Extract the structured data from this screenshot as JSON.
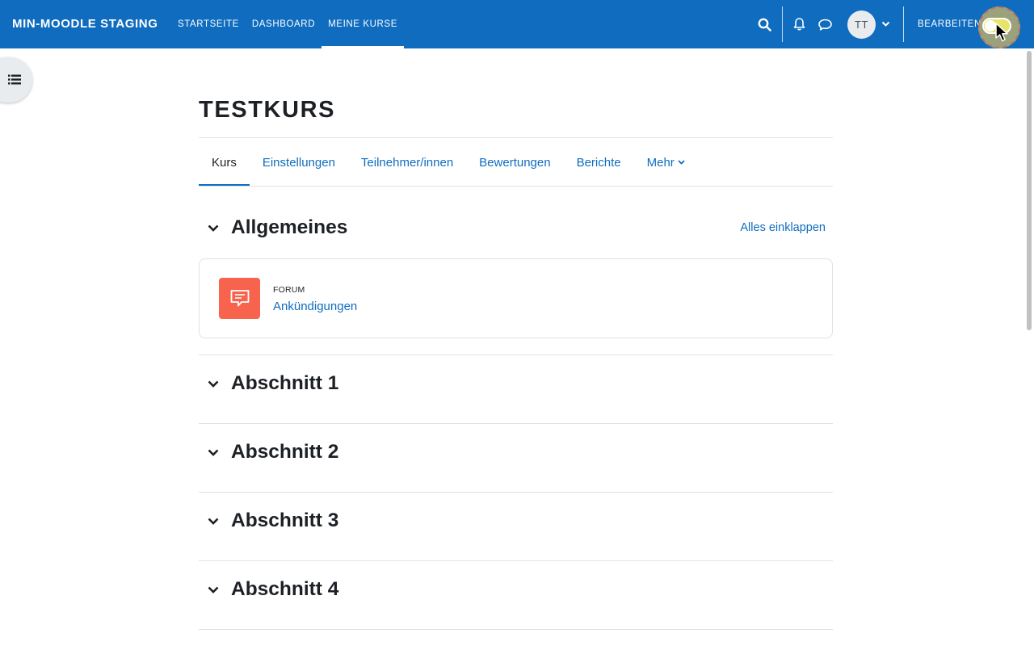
{
  "navbar": {
    "brand": "MIN-MOODLE STAGING",
    "links": [
      {
        "label": "STARTSEITE",
        "active": false
      },
      {
        "label": "DASHBOARD",
        "active": false
      },
      {
        "label": "MEINE KURSE",
        "active": true
      }
    ],
    "icons": [
      "search-icon",
      "bell-icon",
      "chat-bubble-icon",
      "chevron-down-icon"
    ],
    "user_initials": "TT",
    "edit_mode_label": "BEARBEITEN",
    "edit_mode_on": false
  },
  "course": {
    "title": "TESTKURS",
    "tabs": [
      {
        "label": "Kurs",
        "active": true
      },
      {
        "label": "Einstellungen",
        "active": false
      },
      {
        "label": "Teilnehmer/innen",
        "active": false
      },
      {
        "label": "Bewertungen",
        "active": false
      },
      {
        "label": "Berichte",
        "active": false
      },
      {
        "label": "Mehr",
        "active": false,
        "has_dropdown": true
      }
    ],
    "collapse_all_label": "Alles einklappen",
    "sections": [
      {
        "title": "Allgemeines",
        "expanded": true
      },
      {
        "title": "Abschnitt 1",
        "expanded": true
      },
      {
        "title": "Abschnitt 2",
        "expanded": true
      },
      {
        "title": "Abschnitt 3",
        "expanded": true
      },
      {
        "title": "Abschnitt 4",
        "expanded": true
      }
    ],
    "activity": {
      "type_label": "FORUM",
      "name": "Ankündigungen",
      "icon": "forum-icon"
    }
  },
  "colors": {
    "primary": "#0f6cbf",
    "forum_icon_bg": "#f7634d",
    "text": "#1d2125",
    "border": "#dee2e6"
  }
}
